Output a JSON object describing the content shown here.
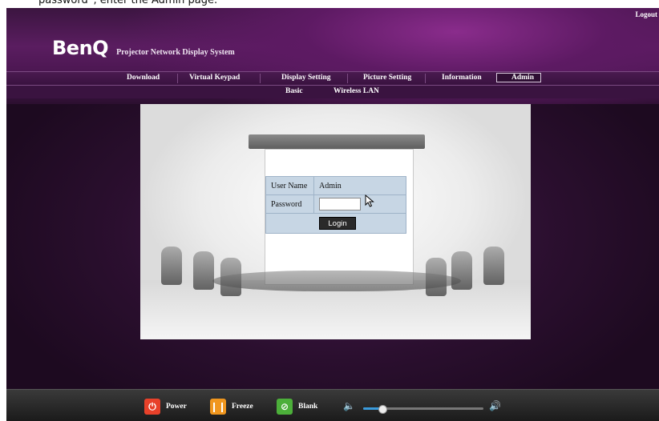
{
  "caption": "password”, enter the Admin page.",
  "header": {
    "logout_label": "Logout",
    "brand_logo": "BenQ",
    "brand_subtitle": "Projector Network Display System"
  },
  "nav": {
    "items": [
      {
        "label": "Download"
      },
      {
        "label": "Virtual Keypad"
      },
      {
        "label": "Display Setting"
      },
      {
        "label": "Picture Setting"
      },
      {
        "label": "Information"
      },
      {
        "label": "Admin",
        "active": true
      }
    ]
  },
  "subnav": {
    "items": [
      {
        "label": "Basic"
      },
      {
        "label": "Wireless LAN"
      }
    ]
  },
  "login": {
    "username_label": "User Name",
    "username_value": "Admin",
    "password_label": "Password",
    "password_value": "",
    "login_label": "Login"
  },
  "controls": {
    "power_label": "Power",
    "freeze_label": "Freeze",
    "blank_label": "Blank",
    "volume": 0.15
  },
  "icons": {
    "power": "power-icon",
    "freeze": "pause-icon",
    "blank": "blank-icon",
    "volume_low": "volume-low-icon",
    "volume_high": "volume-high-icon"
  },
  "colors": {
    "power": "#e8412a",
    "freeze": "#f0961e",
    "blank": "#4caf3a",
    "volume": "#3a9bdc"
  }
}
